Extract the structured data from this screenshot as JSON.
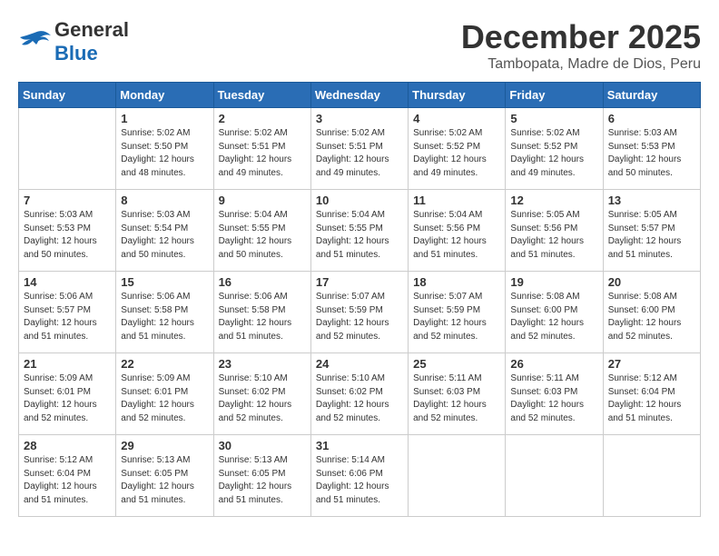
{
  "header": {
    "logo_general": "General",
    "logo_blue": "Blue",
    "month_title": "December 2025",
    "subtitle": "Tambopata, Madre de Dios, Peru"
  },
  "calendar": {
    "days_of_week": [
      "Sunday",
      "Monday",
      "Tuesday",
      "Wednesday",
      "Thursday",
      "Friday",
      "Saturday"
    ],
    "weeks": [
      [
        {
          "day": "",
          "info": ""
        },
        {
          "day": "1",
          "info": "Sunrise: 5:02 AM\nSunset: 5:50 PM\nDaylight: 12 hours\nand 48 minutes."
        },
        {
          "day": "2",
          "info": "Sunrise: 5:02 AM\nSunset: 5:51 PM\nDaylight: 12 hours\nand 49 minutes."
        },
        {
          "day": "3",
          "info": "Sunrise: 5:02 AM\nSunset: 5:51 PM\nDaylight: 12 hours\nand 49 minutes."
        },
        {
          "day": "4",
          "info": "Sunrise: 5:02 AM\nSunset: 5:52 PM\nDaylight: 12 hours\nand 49 minutes."
        },
        {
          "day": "5",
          "info": "Sunrise: 5:02 AM\nSunset: 5:52 PM\nDaylight: 12 hours\nand 49 minutes."
        },
        {
          "day": "6",
          "info": "Sunrise: 5:03 AM\nSunset: 5:53 PM\nDaylight: 12 hours\nand 50 minutes."
        }
      ],
      [
        {
          "day": "7",
          "info": "Sunrise: 5:03 AM\nSunset: 5:53 PM\nDaylight: 12 hours\nand 50 minutes."
        },
        {
          "day": "8",
          "info": "Sunrise: 5:03 AM\nSunset: 5:54 PM\nDaylight: 12 hours\nand 50 minutes."
        },
        {
          "day": "9",
          "info": "Sunrise: 5:04 AM\nSunset: 5:55 PM\nDaylight: 12 hours\nand 50 minutes."
        },
        {
          "day": "10",
          "info": "Sunrise: 5:04 AM\nSunset: 5:55 PM\nDaylight: 12 hours\nand 51 minutes."
        },
        {
          "day": "11",
          "info": "Sunrise: 5:04 AM\nSunset: 5:56 PM\nDaylight: 12 hours\nand 51 minutes."
        },
        {
          "day": "12",
          "info": "Sunrise: 5:05 AM\nSunset: 5:56 PM\nDaylight: 12 hours\nand 51 minutes."
        },
        {
          "day": "13",
          "info": "Sunrise: 5:05 AM\nSunset: 5:57 PM\nDaylight: 12 hours\nand 51 minutes."
        }
      ],
      [
        {
          "day": "14",
          "info": "Sunrise: 5:06 AM\nSunset: 5:57 PM\nDaylight: 12 hours\nand 51 minutes."
        },
        {
          "day": "15",
          "info": "Sunrise: 5:06 AM\nSunset: 5:58 PM\nDaylight: 12 hours\nand 51 minutes."
        },
        {
          "day": "16",
          "info": "Sunrise: 5:06 AM\nSunset: 5:58 PM\nDaylight: 12 hours\nand 51 minutes."
        },
        {
          "day": "17",
          "info": "Sunrise: 5:07 AM\nSunset: 5:59 PM\nDaylight: 12 hours\nand 52 minutes."
        },
        {
          "day": "18",
          "info": "Sunrise: 5:07 AM\nSunset: 5:59 PM\nDaylight: 12 hours\nand 52 minutes."
        },
        {
          "day": "19",
          "info": "Sunrise: 5:08 AM\nSunset: 6:00 PM\nDaylight: 12 hours\nand 52 minutes."
        },
        {
          "day": "20",
          "info": "Sunrise: 5:08 AM\nSunset: 6:00 PM\nDaylight: 12 hours\nand 52 minutes."
        }
      ],
      [
        {
          "day": "21",
          "info": "Sunrise: 5:09 AM\nSunset: 6:01 PM\nDaylight: 12 hours\nand 52 minutes."
        },
        {
          "day": "22",
          "info": "Sunrise: 5:09 AM\nSunset: 6:01 PM\nDaylight: 12 hours\nand 52 minutes."
        },
        {
          "day": "23",
          "info": "Sunrise: 5:10 AM\nSunset: 6:02 PM\nDaylight: 12 hours\nand 52 minutes."
        },
        {
          "day": "24",
          "info": "Sunrise: 5:10 AM\nSunset: 6:02 PM\nDaylight: 12 hours\nand 52 minutes."
        },
        {
          "day": "25",
          "info": "Sunrise: 5:11 AM\nSunset: 6:03 PM\nDaylight: 12 hours\nand 52 minutes."
        },
        {
          "day": "26",
          "info": "Sunrise: 5:11 AM\nSunset: 6:03 PM\nDaylight: 12 hours\nand 52 minutes."
        },
        {
          "day": "27",
          "info": "Sunrise: 5:12 AM\nSunset: 6:04 PM\nDaylight: 12 hours\nand 51 minutes."
        }
      ],
      [
        {
          "day": "28",
          "info": "Sunrise: 5:12 AM\nSunset: 6:04 PM\nDaylight: 12 hours\nand 51 minutes."
        },
        {
          "day": "29",
          "info": "Sunrise: 5:13 AM\nSunset: 6:05 PM\nDaylight: 12 hours\nand 51 minutes."
        },
        {
          "day": "30",
          "info": "Sunrise: 5:13 AM\nSunset: 6:05 PM\nDaylight: 12 hours\nand 51 minutes."
        },
        {
          "day": "31",
          "info": "Sunrise: 5:14 AM\nSunset: 6:06 PM\nDaylight: 12 hours\nand 51 minutes."
        },
        {
          "day": "",
          "info": ""
        },
        {
          "day": "",
          "info": ""
        },
        {
          "day": "",
          "info": ""
        }
      ]
    ]
  }
}
